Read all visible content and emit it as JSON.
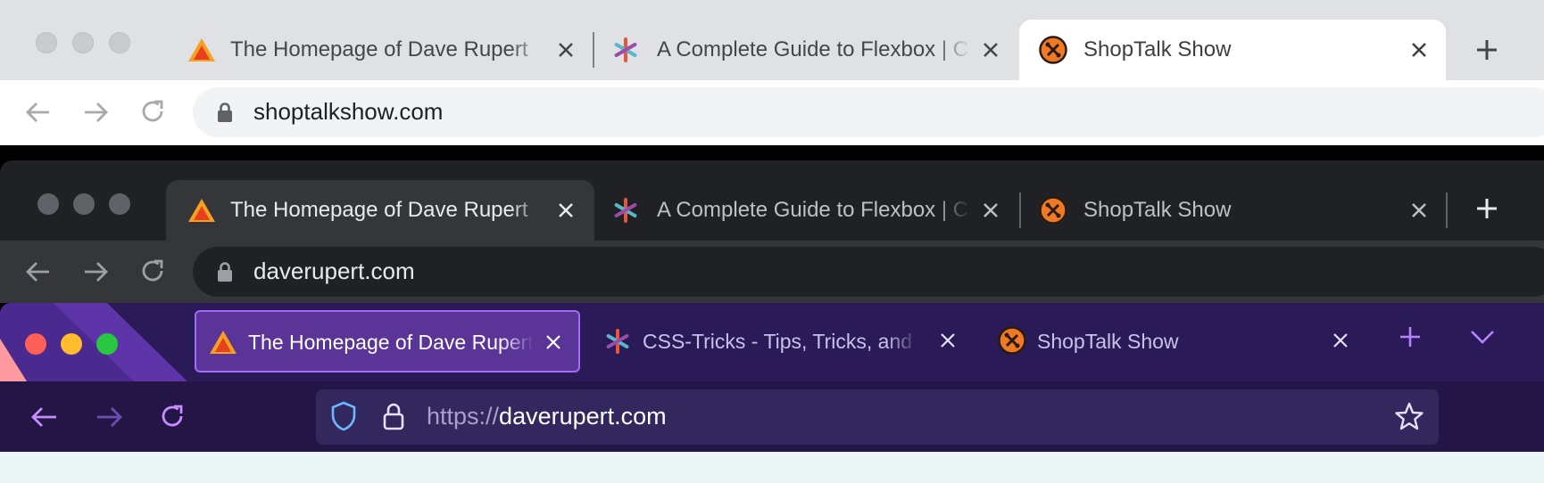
{
  "windows": [
    {
      "theme": "light",
      "tabs": [
        {
          "label": "The Homepage of Dave Rupert",
          "icon": "triangle-logo-icon"
        },
        {
          "label": "A Complete Guide to Flexbox | CSS-Tricks",
          "icon": "asterisk-logo-icon"
        },
        {
          "label": "ShopTalk Show",
          "icon": "shoptalk-logo-icon"
        }
      ],
      "active_tab": 2,
      "url": "shoptalkshow.com"
    },
    {
      "theme": "dark",
      "tabs": [
        {
          "label": "The Homepage of Dave Rupert",
          "icon": "triangle-logo-icon"
        },
        {
          "label": "A Complete Guide to Flexbox | CSS-Tricks",
          "icon": "asterisk-logo-icon"
        },
        {
          "label": "ShopTalk Show",
          "icon": "shoptalk-logo-icon"
        }
      ],
      "active_tab": 0,
      "url": "daverupert.com"
    },
    {
      "theme": "purple",
      "tabs": [
        {
          "label": "The Homepage of Dave Rupert",
          "icon": "triangle-logo-icon"
        },
        {
          "label": "CSS-Tricks - Tips, Tricks, and Techniques",
          "icon": "asterisk-logo-icon"
        },
        {
          "label": "ShopTalk Show",
          "icon": "shoptalk-logo-icon"
        }
      ],
      "active_tab": 0,
      "url_scheme": "https://",
      "url_host": "daverupert.com"
    }
  ],
  "colors": {
    "light_frame": "#dfe1e5",
    "dark_frame": "#202124",
    "purple_frame": "#2a1a57",
    "purple_accent": "#a26cf5"
  }
}
